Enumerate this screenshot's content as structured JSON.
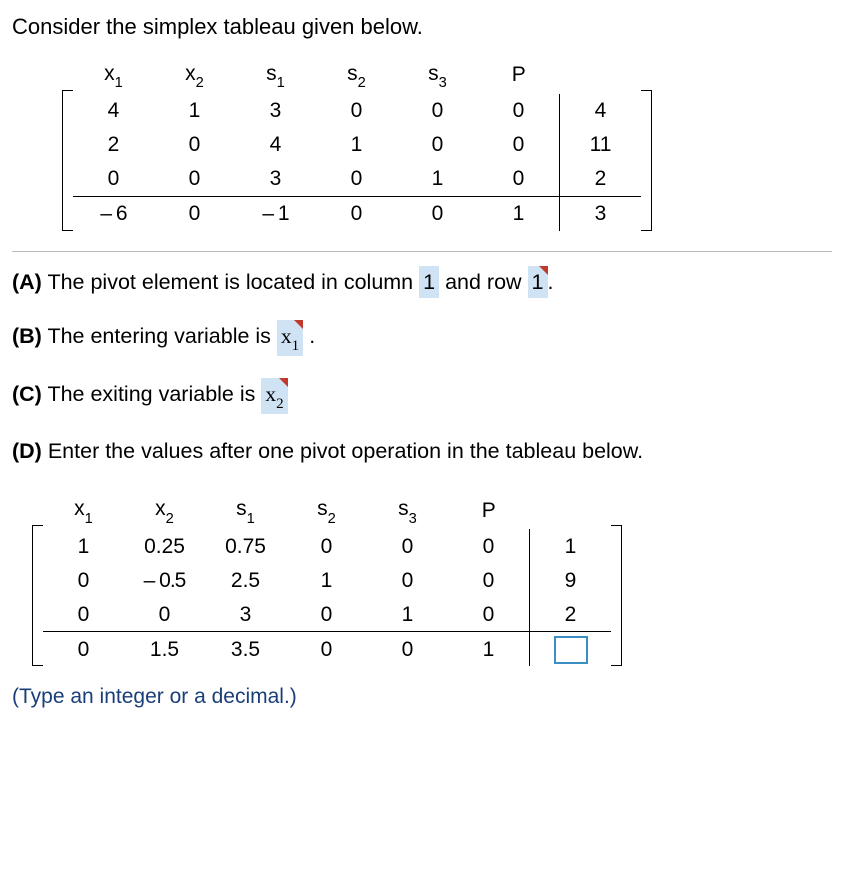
{
  "intro": "Consider the simplex tableau given below.",
  "headers": {
    "x1": "x",
    "x1s": "1",
    "x2": "x",
    "x2s": "2",
    "s1": "s",
    "s1s": "1",
    "s2": "s",
    "s2s": "2",
    "s3": "s",
    "s3s": "3",
    "P": "P"
  },
  "tableau1": {
    "r1": [
      "4",
      "1",
      "3",
      "0",
      "0",
      "0",
      "4"
    ],
    "r2": [
      "2",
      "0",
      "4",
      "1",
      "0",
      "0",
      "11"
    ],
    "r3": [
      "0",
      "0",
      "3",
      "0",
      "1",
      "0",
      "2"
    ],
    "r4": [
      "– 6",
      "0",
      "– 1",
      "0",
      "0",
      "1",
      "3"
    ]
  },
  "partA": {
    "label": "(A)",
    "t1": "The pivot element is located in column ",
    "col": "1",
    "t2": " and row ",
    "row": "1",
    "t3": "."
  },
  "partB": {
    "label": "(B)",
    "t1": "The entering variable is ",
    "var": "x",
    "sub": "1",
    "t3": "."
  },
  "partC": {
    "label": "(C)",
    "t1": "The exiting variable is ",
    "var": "x",
    "sub": "2"
  },
  "partD": {
    "label": "(D)",
    "t1": "Enter the values after one pivot operation in the tableau below."
  },
  "tableau2": {
    "r1": [
      "1",
      "0.25",
      "0.75",
      "0",
      "0",
      "0",
      "1"
    ],
    "r2": [
      "0",
      "– 0.5",
      "2.5",
      "1",
      "0",
      "0",
      "9"
    ],
    "r3": [
      "0",
      "0",
      "3",
      "0",
      "1",
      "0",
      "2"
    ],
    "r4": [
      "0",
      "1.5",
      "3.5",
      "0",
      "0",
      "1",
      ""
    ]
  },
  "help": "(Type an integer or a decimal.)"
}
